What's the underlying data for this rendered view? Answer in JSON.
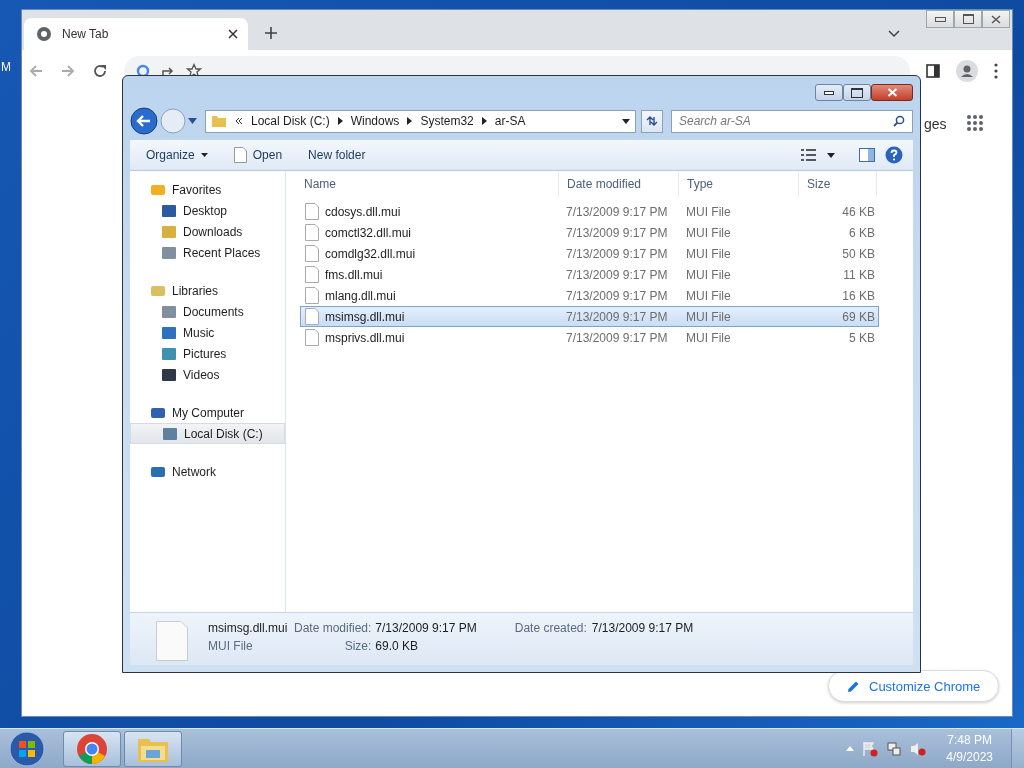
{
  "desktop": {
    "edge_label": "M"
  },
  "browser": {
    "tabs": [
      {
        "title": "New Tab",
        "selected": true
      }
    ],
    "shortcut_link": "ges",
    "customize_button": "Customize Chrome"
  },
  "explorer": {
    "breadcrumb": [
      "Local Disk (C:)",
      "Windows",
      "System32",
      "ar-SA"
    ],
    "search": {
      "placeholder": "Search ar-SA"
    },
    "toolbar": [
      {
        "label": "Organize",
        "kind": "menu"
      },
      {
        "label": "Open",
        "kind": "open"
      },
      {
        "label": "New folder",
        "kind": "plain"
      }
    ],
    "nav": [
      {
        "label": "Favorites",
        "selected": false,
        "children": [
          {
            "label": "Desktop",
            "selected": false
          },
          {
            "label": "Downloads",
            "selected": false
          },
          {
            "label": "Recent Places",
            "selected": false
          }
        ]
      },
      {
        "label": "Libraries",
        "selected": false,
        "children": [
          {
            "label": "Documents",
            "selected": false
          },
          {
            "label": "Music",
            "selected": false
          },
          {
            "label": "Pictures",
            "selected": false
          },
          {
            "label": "Videos",
            "selected": false
          }
        ]
      },
      {
        "label": "My Computer",
        "selected": false,
        "children": [
          {
            "label": "Local Disk (C:)",
            "selected": true
          }
        ]
      },
      {
        "label": "Network",
        "selected": false
      }
    ],
    "columns": [
      "Name",
      "Date modified",
      "Type",
      "Size"
    ],
    "rows": [
      {
        "name": "cdosys.dll.mui",
        "date": "7/13/2009 9:17 PM",
        "type": "MUI File",
        "size": "46 KB",
        "selected": false
      },
      {
        "name": "comctl32.dll.mui",
        "date": "7/13/2009 9:17 PM",
        "type": "MUI File",
        "size": "6 KB",
        "selected": false
      },
      {
        "name": "comdlg32.dll.mui",
        "date": "7/13/2009 9:17 PM",
        "type": "MUI File",
        "size": "50 KB",
        "selected": false
      },
      {
        "name": "fms.dll.mui",
        "date": "7/13/2009 9:17 PM",
        "type": "MUI File",
        "size": "11 KB",
        "selected": false
      },
      {
        "name": "mlang.dll.mui",
        "date": "7/13/2009 9:17 PM",
        "type": "MUI File",
        "size": "16 KB",
        "selected": false
      },
      {
        "name": "msimsg.dll.mui",
        "date": "7/13/2009 9:17 PM",
        "type": "MUI File",
        "size": "69 KB",
        "selected": true
      },
      {
        "name": "msprivs.dll.mui",
        "date": "7/13/2009 9:17 PM",
        "type": "MUI File",
        "size": "5 KB",
        "selected": false
      }
    ],
    "details": {
      "name": "msimsg.dll.mui",
      "type": "MUI File",
      "modified_label": "Date modified:",
      "modified": "7/13/2009 9:17 PM",
      "created_label": "Date created:",
      "created": "7/13/2009 9:17 PM",
      "size_label": "Size:",
      "size": "69.0 KB"
    }
  },
  "taskbar": {
    "apps": [
      {
        "kind": "chrome"
      },
      {
        "kind": "explorer"
      }
    ],
    "time": "7:48 PM",
    "date": "4/9/2023"
  }
}
